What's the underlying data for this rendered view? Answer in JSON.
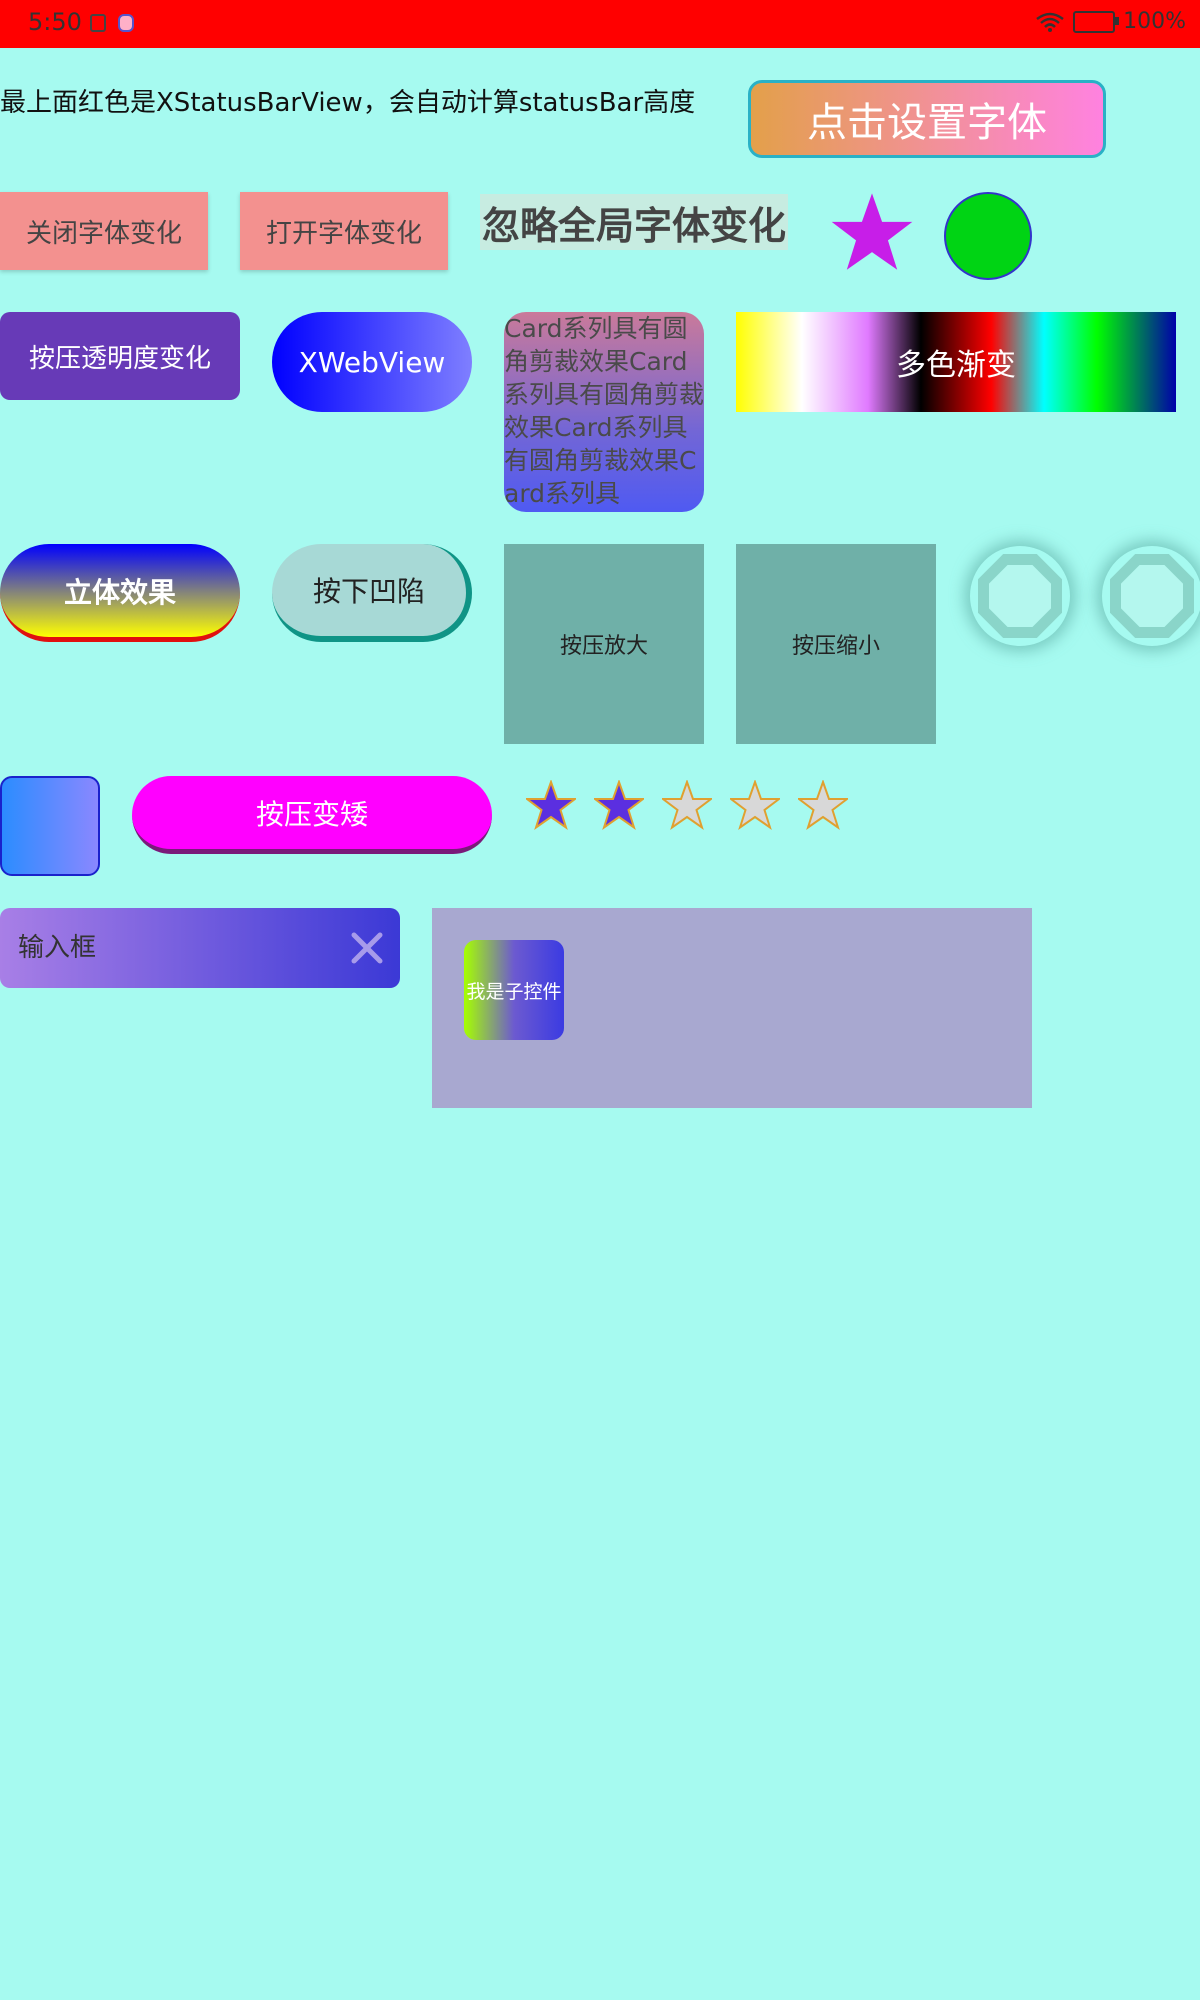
{
  "status_bar": {
    "time": "5:50",
    "battery_text": "100%",
    "icons": [
      "notification-icon",
      "avatar-icon",
      "wifi-icon",
      "battery-icon"
    ]
  },
  "description": "最上面红色是XStatusBarView，会自动计算statusBar高度",
  "buttons": {
    "set_font": "点击设置字体",
    "close_font_change": "关闭字体变化",
    "open_font_change": "打开字体变化",
    "ignore_global_font": "忽略全局字体变化",
    "alpha_press": "按压透明度变化",
    "webview": "XWebView",
    "card_text": "Card系列具有圆角剪裁效果Card系列具有圆角剪裁效果Card系列具有圆角剪裁效果Card系列具",
    "multi_gradient": "多色渐变",
    "stereo": "立体效果",
    "concave": "按下凹陷",
    "press_enlarge": "按压放大",
    "press_shrink": "按压缩小",
    "press_short": "按压变矮",
    "child_control": "我是子控件"
  },
  "rating": {
    "value": 2,
    "max": 5
  },
  "input": {
    "placeholder": "输入框",
    "value": ""
  },
  "colors": {
    "background": "#a6faf0",
    "status_bar": "#ff0000",
    "star_magenta": "#c71ee8",
    "circle_green": "#00d414",
    "rating_filled": "#5b2fe0",
    "rating_empty": "#d8d8d8"
  }
}
